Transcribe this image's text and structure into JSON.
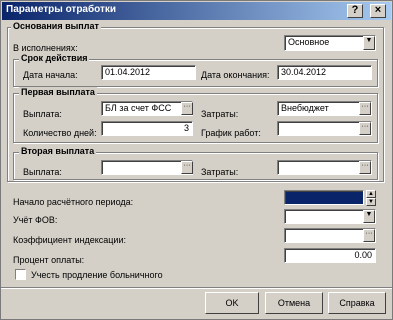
{
  "window": {
    "title": "Параметры отработки",
    "help_icon": "?",
    "close_icon": "×"
  },
  "basis": {
    "group_title": "Основания выплат",
    "in_execution_label": "В исполнениях:",
    "in_execution_value": "Основное",
    "period": {
      "group_title": "Срок действия",
      "start_label": "Дата начала:",
      "start_value": "01.04.2012",
      "end_label": "Дата окончания:",
      "end_value": "30.04.2012"
    }
  },
  "first_payment": {
    "group_title": "Первая выплата",
    "payment_label": "Выплата:",
    "payment_value": "БЛ за счет ФСС",
    "costs_label": "Затраты:",
    "costs_value": "Внебюджет",
    "days_label": "Количество дней:",
    "days_value": "3",
    "schedule_label": "График работ:",
    "schedule_value": ""
  },
  "second_payment": {
    "group_title": "Вторая выплата",
    "payment_label": "Выплата:",
    "payment_value": "",
    "costs_label": "Затраты:",
    "costs_value": ""
  },
  "settings": {
    "period_start_label": "Начало расчётного периода:",
    "fov_label": "Учёт ФОВ:",
    "coef_label": "Коэффициент индексации:",
    "percent_label": "Процент оплаты:",
    "percent_value": "0.00",
    "sick_leave_label": "Учесть продление больничного",
    "sick_leave_checked": false,
    "highlight_color": "#0a246a"
  },
  "buttons": {
    "ok": "OK",
    "cancel": "Отмена",
    "help": "Справка"
  }
}
